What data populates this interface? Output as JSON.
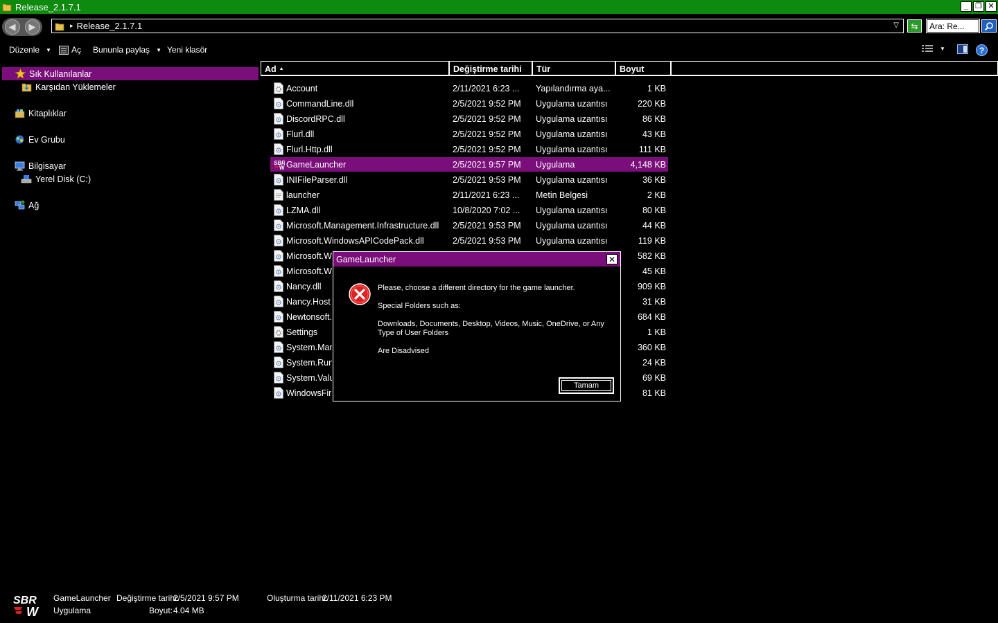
{
  "window": {
    "title": "Release_2.1.7.1",
    "min_label": "_",
    "max_label": "❐",
    "close_label": "✕"
  },
  "address": {
    "path": "Release_2.1.7.1",
    "search_value": "Ara: Re..."
  },
  "toolbar": {
    "organize": "Düzenle",
    "open": "Aç",
    "share": "Bununla paylaş",
    "new_folder": "Yeni klasör",
    "help": "?"
  },
  "nav": {
    "favorites": "Sık Kullanılanlar",
    "downloads": "Karşıdan Yüklemeler",
    "libraries": "Kitaplıklar",
    "homegroup": "Ev Grubu",
    "computer": "Bilgisayar",
    "local_disk": "Yerel Disk (C:)",
    "network": "Ağ"
  },
  "columns": {
    "name": "Ad",
    "date": "Değiştirme tarihi",
    "type": "Tür",
    "size": "Boyut"
  },
  "files": [
    {
      "name": "Account",
      "date": "2/11/2021 6:23 ...",
      "type": "Yapılandırma aya...",
      "size": "1 KB",
      "icon": "config-file-icon"
    },
    {
      "name": "CommandLine.dll",
      "date": "2/5/2021 9:52 PM",
      "type": "Uygulama uzantısı",
      "size": "220 KB",
      "icon": "dll-file-icon"
    },
    {
      "name": "DiscordRPC.dll",
      "date": "2/5/2021 9:52 PM",
      "type": "Uygulama uzantısı",
      "size": "86 KB",
      "icon": "dll-file-icon"
    },
    {
      "name": "Flurl.dll",
      "date": "2/5/2021 9:52 PM",
      "type": "Uygulama uzantısı",
      "size": "43 KB",
      "icon": "dll-file-icon"
    },
    {
      "name": "Flurl.Http.dll",
      "date": "2/5/2021 9:52 PM",
      "type": "Uygulama uzantısı",
      "size": "111 KB",
      "icon": "dll-file-icon"
    },
    {
      "name": "GameLauncher",
      "date": "2/5/2021 9:57 PM",
      "type": "Uygulama",
      "size": "4,148 KB",
      "icon": "sbrw-app-icon"
    },
    {
      "name": "INIFileParser.dll",
      "date": "2/5/2021 9:53 PM",
      "type": "Uygulama uzantısı",
      "size": "36 KB",
      "icon": "dll-file-icon"
    },
    {
      "name": "launcher",
      "date": "2/11/2021 6:23 ...",
      "type": "Metin Belgesi",
      "size": "2 KB",
      "icon": "text-file-icon"
    },
    {
      "name": "LZMA.dll",
      "date": "10/8/2020 7:02 ...",
      "type": "Uygulama uzantısı",
      "size": "80 KB",
      "icon": "dll-file-icon"
    },
    {
      "name": "Microsoft.Management.Infrastructure.dll",
      "date": "2/5/2021 9:53 PM",
      "type": "Uygulama uzantısı",
      "size": "44 KB",
      "icon": "dll-file-icon"
    },
    {
      "name": "Microsoft.WindowsAPICodePack.dll",
      "date": "2/5/2021 9:53 PM",
      "type": "Uygulama uzantısı",
      "size": "119 KB",
      "icon": "dll-file-icon"
    },
    {
      "name": "Microsoft.W",
      "date": "",
      "type": "",
      "size": "582 KB",
      "icon": "dll-file-icon"
    },
    {
      "name": "Microsoft.W",
      "date": "",
      "type": "",
      "size": "45 KB",
      "icon": "dll-file-icon"
    },
    {
      "name": "Nancy.dll",
      "date": "",
      "type": "",
      "size": "909 KB",
      "icon": "dll-file-icon"
    },
    {
      "name": "Nancy.Host",
      "date": "",
      "type": "",
      "size": "31 KB",
      "icon": "dll-file-icon"
    },
    {
      "name": "Newtonsoft.",
      "date": "",
      "type": "",
      "size": "684 KB",
      "icon": "dll-file-icon"
    },
    {
      "name": "Settings",
      "date": "",
      "type": "",
      "size": "1 KB",
      "icon": "config-file-icon"
    },
    {
      "name": "System.Man",
      "date": "",
      "type": "",
      "size": "360 KB",
      "icon": "dll-file-icon"
    },
    {
      "name": "System.Run",
      "date": "",
      "type": "",
      "size": "24 KB",
      "icon": "dll-file-icon"
    },
    {
      "name": "System.Valu",
      "date": "",
      "type": "",
      "size": "69 KB",
      "icon": "dll-file-icon"
    },
    {
      "name": "WindowsFir",
      "date": "",
      "type": "",
      "size": "81 KB",
      "icon": "dll-file-icon"
    }
  ],
  "selected_index": 5,
  "dialog": {
    "title": "GameLauncher",
    "close_label": "✕",
    "line1": "Please, choose a different directory for the game launcher.",
    "line2": "Special Folders such as:",
    "line3": "Downloads, Documents, Desktop, Videos, Music, OneDrive, or Any Type of User Folders",
    "line4": "Are Disadvised",
    "ok": "Tamam"
  },
  "details": {
    "name": "GameLauncher",
    "modified_label": "Değiştirme tarihi:",
    "modified_value": "2/5/2021 9:57 PM",
    "created_label": "Oluşturma tarihi:",
    "created_value": "2/11/2021 6:23 PM",
    "type": "Uygulama",
    "size_label": "Boyut:",
    "size_value": "4.04 MB",
    "logo_text_top": "SBR",
    "logo_text_bottom": "W"
  },
  "colors": {
    "titlebar": "#0e8a0e",
    "selection": "#7a0e7a",
    "background": "#000000"
  }
}
